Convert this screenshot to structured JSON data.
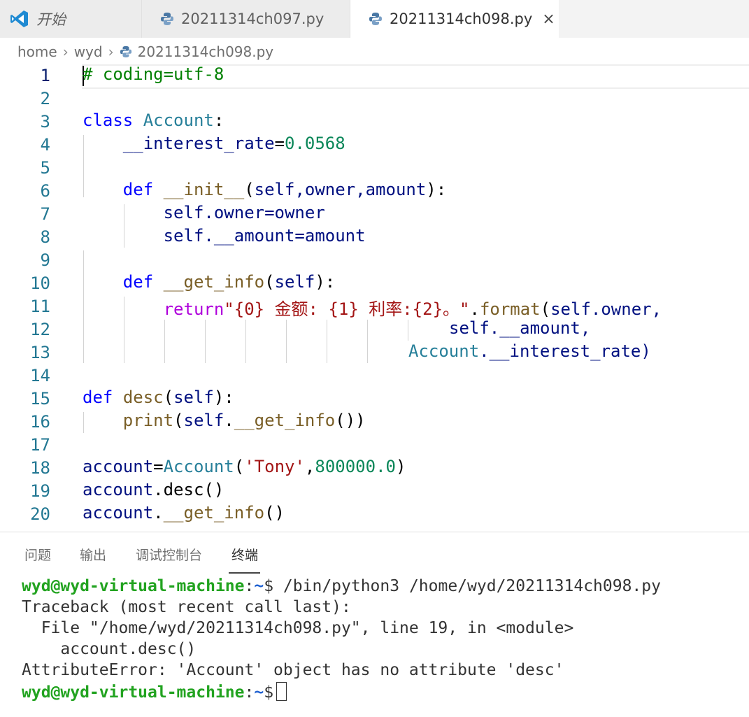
{
  "tabs": {
    "start_label": "开始",
    "tab1_label": "20211314ch097.py",
    "tab2_label": "20211314ch098.py",
    "close_glyph": "×"
  },
  "breadcrumb": {
    "p1": "home",
    "p2": "wyd",
    "p3": "20211314ch098.py",
    "sep": "›"
  },
  "line_numbers": [
    "1",
    "2",
    "3",
    "4",
    "5",
    "6",
    "7",
    "8",
    "9",
    "10",
    "11",
    "12",
    "13",
    "14",
    "15",
    "16",
    "17",
    "18",
    "19",
    "20"
  ],
  "code": {
    "l1": "# coding=utf-8",
    "l3_kw": "class",
    "l3_name": "Account",
    "l3_colon": ":",
    "l4_var": "__interest_rate",
    "l4_eq": "=",
    "l4_num": "0.0568",
    "l6_kw": "def",
    "l6_fn": "__init__",
    "l6_open": "(",
    "l6_params": "self,owner,amount",
    "l6_close": "):",
    "l7_a": "self",
    "l7_b": ".owner=owner",
    "l8_a": "self",
    "l8_b": ".__amount=amount",
    "l10_kw": "def",
    "l10_fn": "__get_info",
    "l10_open": "(",
    "l10_param": "self",
    "l10_close": "):",
    "l11_kw": "return",
    "l11_str": "\"{0} 金额: {1} 利率:{2}。\"",
    "l11_dot": ".",
    "l11_fn": "format",
    "l11_open": "(",
    "l11_args": "self.owner,",
    "l12": "self.__amount,",
    "l13_cls": "Account",
    "l13_rest": ".__interest_rate)",
    "l15_kw": "def",
    "l15_fn": "desc",
    "l15_open": "(",
    "l15_param": "self",
    "l15_close": "):",
    "l16_fn": "print",
    "l16_open": "(",
    "l16_self": "self",
    "l16_dot": ".",
    "l16_call": "__get_info",
    "l16_close": "())",
    "l18_var": "account",
    "l18_eq": "=",
    "l18_cls": "Account",
    "l18_open": "(",
    "l18_str": "'Tony'",
    "l18_comma": ",",
    "l18_num": "800000.0",
    "l18_close": ")",
    "l19_var": "account",
    "l19_rest": ".desc()",
    "l20_var": "account",
    "l20_dot": ".",
    "l20_fn": "__get_info",
    "l20_close": "()"
  },
  "panel": {
    "tabs": [
      "问题",
      "输出",
      "调试控制台",
      "终端"
    ],
    "active_tab": "终端"
  },
  "terminal": {
    "prompt_user": "wyd@wyd-virtual-machine",
    "prompt_colon": ":",
    "prompt_tilde": "~",
    "prompt_dollar": "$",
    "command": " /bin/python3 /home/wyd/20211314ch098.py",
    "line2": "Traceback (most recent call last):",
    "line3": "  File \"/home/wyd/20211314ch098.py\", line 19, in <module>",
    "line4": "    account.desc()",
    "line5": "AttributeError: 'Account' object has no attribute 'desc'"
  },
  "colors": {
    "keyword": "#0000ff",
    "comment": "#008000",
    "class": "#267f99",
    "variable": "#001080",
    "number": "#098658",
    "function": "#795e26",
    "string": "#a31515",
    "control": "#af00db",
    "prompt": "#22a320",
    "line_number": "#237893"
  },
  "icons": [
    "vscode-logo-icon",
    "python-file-icon",
    "close-icon"
  ]
}
